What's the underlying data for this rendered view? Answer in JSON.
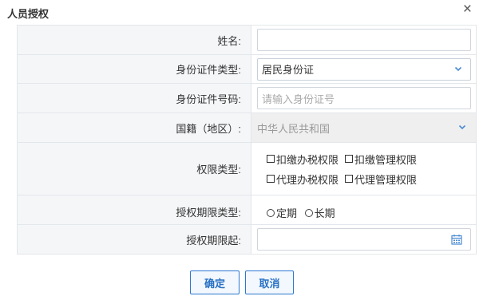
{
  "dialog": {
    "title": "人员授权",
    "close_glyph": "×"
  },
  "form": {
    "name": {
      "label": "姓名:",
      "value": ""
    },
    "id_type": {
      "label": "身份证件类型:",
      "value": "居民身份证"
    },
    "id_number": {
      "label": "身份证件号码:",
      "placeholder": "请输入身份证号"
    },
    "nationality": {
      "label": "国籍（地区）:",
      "value": "中华人民共和国"
    },
    "permission_type": {
      "label": "权限类型:",
      "options": [
        "扣缴办税权限",
        "扣缴管理权限",
        "代理办税权限",
        "代理管理权限"
      ]
    },
    "period_type": {
      "label": "授权期限类型:",
      "options": [
        "定期",
        "长期"
      ]
    },
    "period_start": {
      "label": "授权期限起:",
      "value": ""
    }
  },
  "buttons": {
    "confirm": "确定",
    "cancel": "取消"
  },
  "colors": {
    "accent": "#2b77cf",
    "label_bg": "#f4f6f8",
    "border": "#e3e6ea"
  }
}
